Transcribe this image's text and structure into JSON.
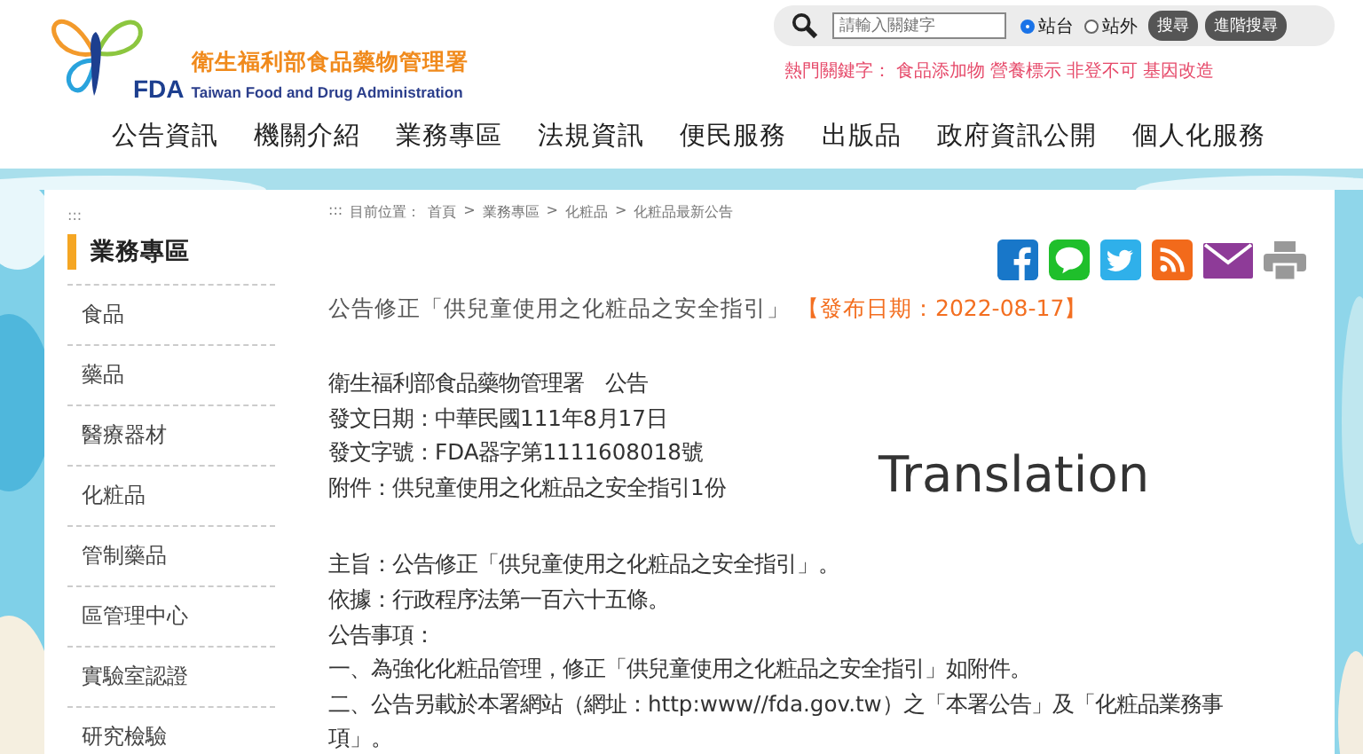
{
  "logo": {
    "mark": "FDA",
    "name_zh": "衛生福利部食品藥物管理署",
    "name_en": "Taiwan Food and Drug Administration"
  },
  "search": {
    "placeholder": "請輸入關鍵字",
    "scopes": [
      {
        "label": "站台",
        "selected": true
      },
      {
        "label": "站外",
        "selected": false
      }
    ],
    "buttons": [
      "搜尋",
      "進階搜尋"
    ]
  },
  "hot_keywords": {
    "label": "熱門關鍵字：",
    "items": [
      "食品添加物",
      "營養標示",
      "非登不可",
      "基因改造"
    ]
  },
  "nav": [
    "公告資訊",
    "機關介紹",
    "業務專區",
    "法規資訊",
    "便民服務",
    "出版品",
    "政府資訊公開",
    "個人化服務"
  ],
  "sidebar": {
    "marker": ":::",
    "title": "業務專區",
    "items": [
      "食品",
      "藥品",
      "醫療器材",
      "化粧品",
      "管制藥品",
      "區管理中心",
      "實驗室認證",
      "研究檢驗"
    ]
  },
  "breadcrumb": {
    "marker": ":::",
    "label": "目前位置：",
    "separator": ">",
    "items": [
      "首頁",
      "業務專區",
      "化粧品",
      "化粧品最新公告"
    ]
  },
  "article": {
    "title": "公告修正「供兒童使用之化粧品之安全指引」",
    "date": "【發布日期：2022-08-17】",
    "header_lines": [
      "衛生福利部食品藥物管理署　公告",
      "發文日期：中華民國111年8月17日",
      "發文字號：FDA器字第1111608018號",
      "附件：供兒童使用之化粧品之安全指引1份"
    ],
    "body_lines": [
      "主旨：公告修正「供兒童使用之化粧品之安全指引」。",
      "依據：行政程序法第一百六十五條。",
      "公告事項：",
      "一、為強化化粧品管理，修正「供兒童使用之化粧品之安全指引」如附件。",
      "二、公告另載於本署網站（網址：http:www//fda.gov.tw）之「本署公告」及「化粧品業務事項」。"
    ]
  },
  "overlay_label": "Translation"
}
